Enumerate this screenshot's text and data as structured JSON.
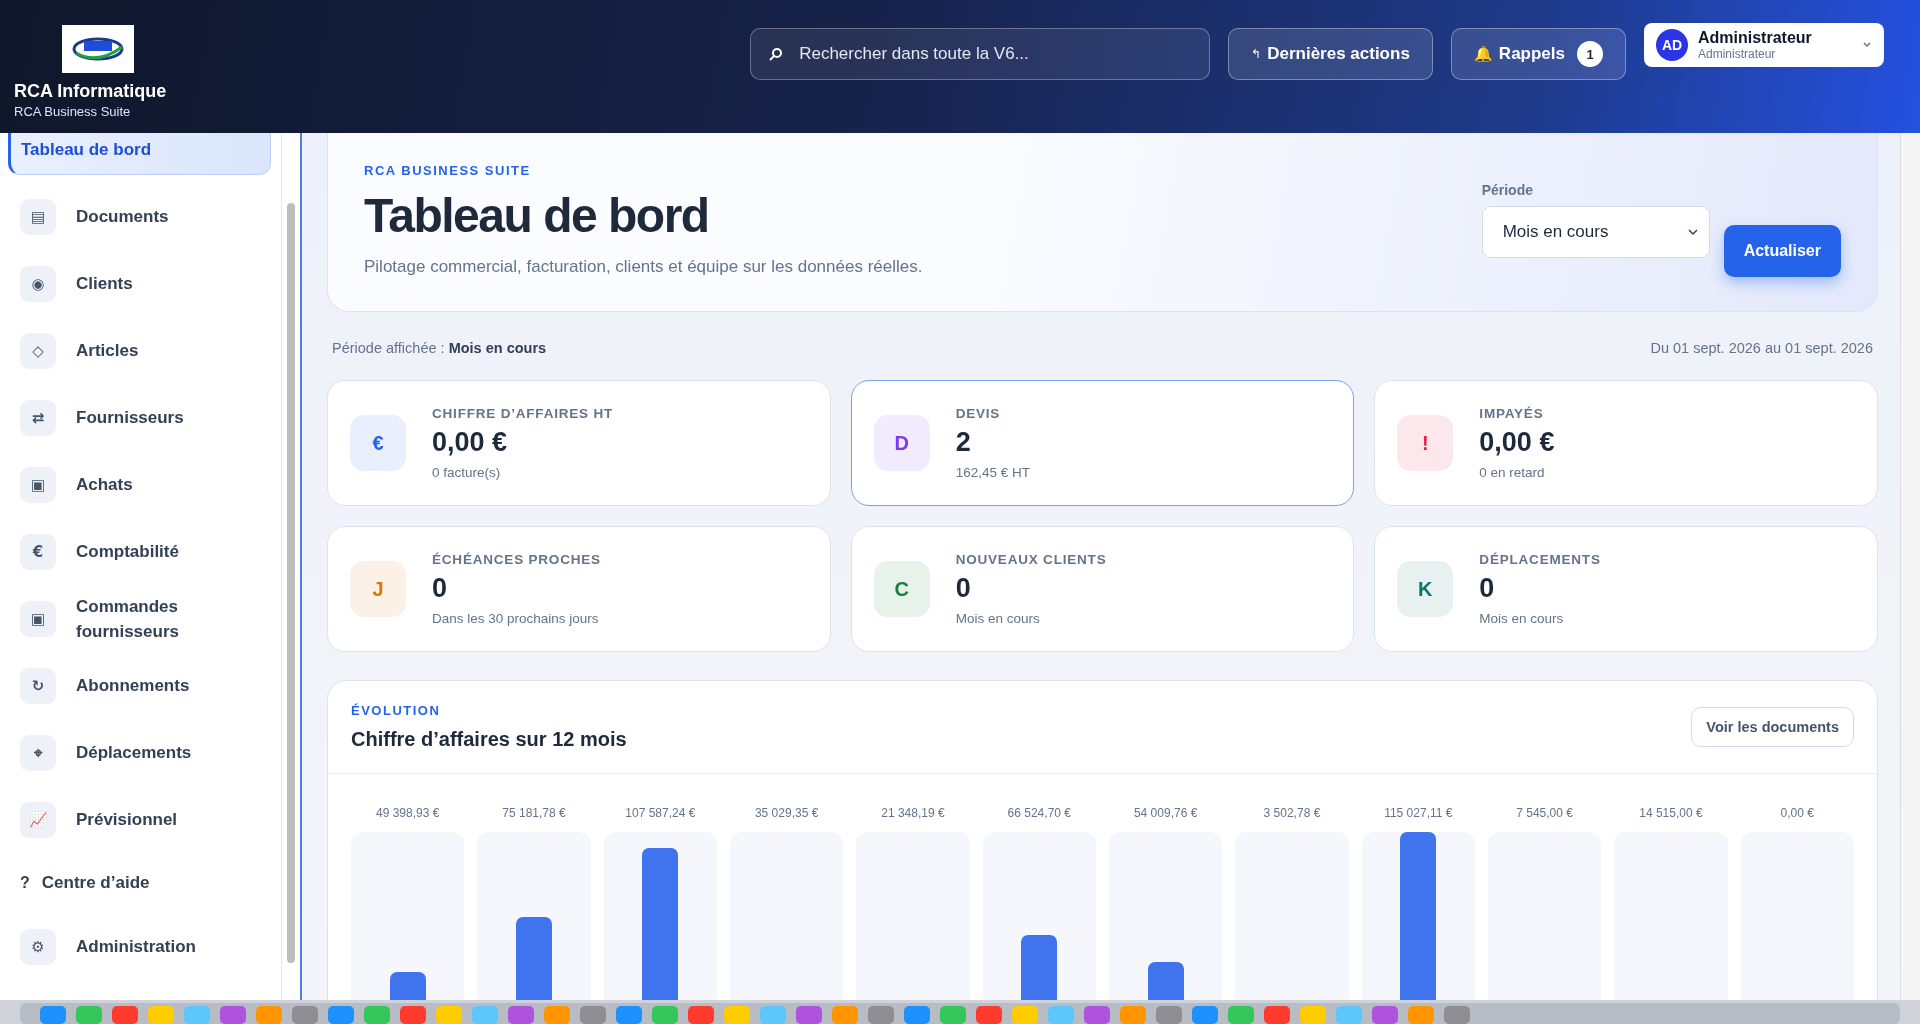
{
  "header": {
    "company": "RCA Informatique",
    "product": "RCA Business Suite",
    "search": {
      "placeholder": "Rechercher dans toute la V6..."
    },
    "actions_icon": "↰",
    "actions_label": "Dernières actions",
    "reminders_icon": "🔔",
    "reminders_label": "Rappels",
    "reminders_count": "1",
    "user": {
      "initials": "AD",
      "name": "Administrateur",
      "role": "Administrateur"
    }
  },
  "sidebar": {
    "items": [
      {
        "kind": "nav",
        "label": "Tableau de bord",
        "selected": true
      },
      {
        "kind": "nav",
        "icon": "▤",
        "label": "Documents",
        "selected": false
      },
      {
        "kind": "nav",
        "icon": "◉",
        "label": "Clients",
        "selected": false
      },
      {
        "kind": "nav",
        "icon": "◇",
        "label": "Articles",
        "selected": false
      },
      {
        "kind": "nav",
        "icon": "⇄",
        "label": "Fournisseurs",
        "selected": false
      },
      {
        "kind": "nav",
        "icon": "▣",
        "label": "Achats",
        "selected": false
      },
      {
        "kind": "nav",
        "icon": "€",
        "label": "Comptabilité",
        "selected": false
      },
      {
        "kind": "nav",
        "icon": "▣",
        "label": "Commandes fournisseurs",
        "selected": false
      },
      {
        "kind": "nav",
        "icon": "↻",
        "label": "Abonnements",
        "selected": false
      },
      {
        "kind": "nav",
        "icon": "⌖",
        "label": "Déplacements",
        "selected": false
      },
      {
        "kind": "nav",
        "icon": "📈",
        "label": "Prévisionnel",
        "selected": false
      },
      {
        "kind": "help",
        "icon": "?",
        "label": "Centre d’aide",
        "selected": false
      },
      {
        "kind": "nav",
        "icon": "⚙",
        "label": "Administration",
        "selected": false
      }
    ]
  },
  "hero": {
    "eyebrow": "RCA BUSINESS SUITE",
    "title": "Tableau de bord",
    "subtitle": "Pilotage commercial, facturation, clients et équipe sur les données réelles.",
    "period_label": "Période",
    "period_value": "Mois en cours",
    "refresh": "Actualiser"
  },
  "period_bar": {
    "text": "Période affichée : **Mois en cours**",
    "range": "Du 01 sept. 2026 au 01 sept. 2026"
  },
  "kpis": [
    {
      "letter": "€",
      "color": "#2563eb",
      "label": "CHIFFRE D’AFFAIRES HT",
      "value": "0,00 €",
      "note": "0 facture(s)",
      "selected": false
    },
    {
      "letter": "D",
      "color": "#7c3aed",
      "label": "DEVIS",
      "value": "2",
      "note": "162,45 € HT",
      "selected": true
    },
    {
      "letter": "!",
      "color": "#e11d48",
      "label": "IMPAYÉS",
      "value": "0,00 €",
      "note": "0 en retard",
      "selected": false
    },
    {
      "letter": "J",
      "color": "#d97706",
      "label": "ÉCHÉANCES PROCHES",
      "value": "0",
      "note": "Dans les 30 prochains jours",
      "selected": false
    },
    {
      "letter": "C",
      "color": "#15803d",
      "label": "NOUVEAUX CLIENTS",
      "value": "0",
      "note": "Mois en cours",
      "selected": false
    },
    {
      "letter": "K",
      "color": "#0f766e",
      "label": "DÉPLACEMENTS",
      "value": "0",
      "note": "Mois en cours",
      "selected": false
    }
  ],
  "evolution": {
    "eyebrow": "ÉVOLUTION",
    "title": "Chiffre d’affaires sur 12 mois",
    "button": "Voir les documents",
    "value_labels": [
      "49 398,93 €",
      "75 181,78 €",
      "107 587,24 €",
      "35 029,35 €",
      "21 348,19 €",
      "66 524,70 €",
      "54 009,76 €",
      "3 502,78 €",
      "115 027,11 €",
      "7 545,00 €",
      "14 515,00 €",
      "0,00 €"
    ]
  }
}
